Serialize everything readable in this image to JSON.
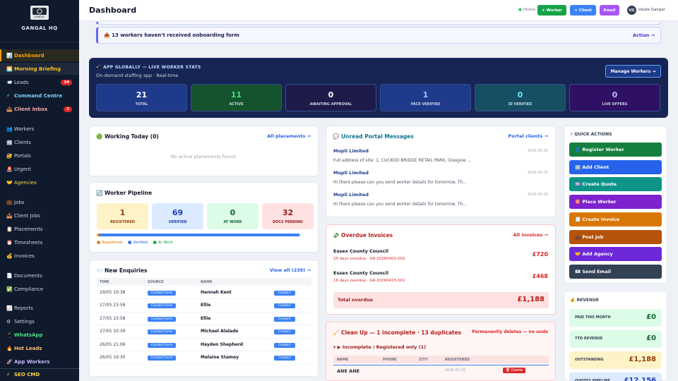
{
  "sidebar": {
    "brand": "GANGAL HQ",
    "logo_text": "GANGAL",
    "items": [
      {
        "icon": "📊",
        "label": "Dashboard"
      },
      {
        "icon": "🌅",
        "label": "Morning Briefing"
      },
      {
        "icon": "📨",
        "label": "Leads",
        "badge": "24"
      },
      {
        "icon": "⚡",
        "label": "Command Centre"
      },
      {
        "icon": "📥",
        "label": "Client Inbox",
        "badge": "2"
      },
      {
        "icon": "👥",
        "label": "Workers"
      },
      {
        "icon": "🏢",
        "label": "Clients"
      },
      {
        "icon": "🔐",
        "label": "Portals"
      },
      {
        "icon": "🚨",
        "label": "Urgent"
      },
      {
        "icon": "🤝",
        "label": "Agencies"
      },
      {
        "icon": "💼",
        "label": "Jobs"
      },
      {
        "icon": "📥",
        "label": "Client Jobs"
      },
      {
        "icon": "📋",
        "label": "Placements"
      },
      {
        "icon": "⏰",
        "label": "Timesheets"
      },
      {
        "icon": "💰",
        "label": "Invoices"
      },
      {
        "icon": "📄",
        "label": "Documents"
      },
      {
        "icon": "✅",
        "label": "Compliance"
      },
      {
        "icon": "📈",
        "label": "Reports"
      },
      {
        "icon": "⚙",
        "label": "Settings"
      },
      {
        "icon": "📱",
        "label": "WhatsApp"
      },
      {
        "icon": "🔥",
        "label": "Hot Leads"
      },
      {
        "icon": "🚀",
        "label": "App Workers"
      },
      {
        "icon": "⚡",
        "label": "SEO CMD"
      }
    ]
  },
  "topbar": {
    "title": "Dashboard",
    "status": "Online",
    "btn_worker": "+ Worker",
    "btn_client": "+ Client",
    "btn_email": "Email",
    "avatar": "VG",
    "user": "Vasile Gangal"
  },
  "onboarding": {
    "text": "📤 13 workers haven't received onboarding form",
    "action": "Action →"
  },
  "stats": {
    "heading": "📲 APP GLOBALLY — LIVE WORKER STATS",
    "subtitle": "On-demand staffing app · Real-time",
    "manage": "Manage Workers →",
    "items": [
      {
        "value": "21",
        "label": "TOTAL",
        "color": "#ffffff"
      },
      {
        "value": "11",
        "label": "ACTIVE",
        "color": "#4ade80"
      },
      {
        "value": "0",
        "label": "AWAITING APPROVAL",
        "color": "#ffffff"
      },
      {
        "value": "1",
        "label": "FACE VERIFIED",
        "color": "#93c5fd"
      },
      {
        "value": "0",
        "label": "ID VERIFIED",
        "color": "#67e8f9"
      },
      {
        "value": "0",
        "label": "LIVE OFFERS",
        "color": "#c4b5fd"
      }
    ]
  },
  "working": {
    "title": "🟢 Working Today (0)",
    "link": "All placements →",
    "empty": "No active placements found."
  },
  "pipeline": {
    "title": "🔄 Worker Pipeline",
    "items": [
      {
        "value": "1",
        "label": "REGISTERED"
      },
      {
        "value": "69",
        "label": "VERIFIED"
      },
      {
        "value": "0",
        "label": "AT WORK"
      },
      {
        "value": "32",
        "label": "DOCS PENDING"
      }
    ],
    "progress": {
      "registered": 0.012,
      "verified": 0.988,
      "at_work": 0
    },
    "legend": [
      "Registered",
      "Verified",
      "At Work"
    ]
  },
  "enquiries": {
    "title": "📨 New Enquiries",
    "link": "View all (239) →",
    "headers": [
      "TIME",
      "SOURCE",
      "NAME",
      ""
    ],
    "rows": [
      {
        "time": "29/05 10:38",
        "source": "Contact Form",
        "name": "Hannah Kent",
        "action": "Contact"
      },
      {
        "time": "27/05 23:58",
        "source": "Contact Form",
        "name": "Ellie",
        "action": "Contact"
      },
      {
        "time": "27/05 23:58",
        "source": "Contact Form",
        "name": "Ellie",
        "action": "Contact"
      },
      {
        "time": "27/05 10:39",
        "source": "Contact Form",
        "name": "Michael Alalade",
        "action": "Contact"
      },
      {
        "time": "26/05 21:06",
        "source": "Contact Form",
        "name": "Hayden Shepherd",
        "action": "Contact"
      },
      {
        "time": "26/05 19:30",
        "source": "Contact Form",
        "name": "Melaine Stamey",
        "action": "Contact"
      }
    ]
  },
  "messages": {
    "title": "💬 Unread Portal Messages",
    "link": "Portal clients →",
    "items": [
      {
        "sender": "Mopli Limited",
        "date": "2026-05-25",
        "body": "Full address of site: 1, CUCKOO BRIDGE RETAIL PARK, Glasgow ..."
      },
      {
        "sender": "Mopli Limited",
        "date": "2026-05-25",
        "body": "Hi there please can you send worker details for tomorrow. Th..."
      },
      {
        "sender": "Mopli Limited",
        "date": "2026-05-25",
        "body": "Hi there please can you send worker details for tomorrow. Th..."
      }
    ]
  },
  "invoices": {
    "title": "💸 Overdue Invoices",
    "link": "All invoices →",
    "items": [
      {
        "client": "Essex County Council",
        "info": "25 days overdue · GR-20260402-002",
        "amount": "£720"
      },
      {
        "client": "Essex County Council",
        "info": "18 days overdue · GR-20260415-001",
        "amount": "£468"
      }
    ],
    "total_label": "Total overdue",
    "total": "£1,188"
  },
  "cleanup": {
    "title": "🧹 Clean Up — 1 incomplete · 13 duplicates",
    "warn": "Permanently deletes — no undo",
    "section": "▾ ▶ Incomplete / Registered only (1)",
    "headers": [
      "NAME",
      "PHONE",
      "CITY",
      "REGISTERED"
    ],
    "row": {
      "name": "ANE ANE",
      "date": "2026-05-25",
      "action": "🗑 Delete"
    }
  },
  "quick_actions": {
    "title": "⚡ QUICK ACTIONS",
    "items": [
      {
        "label": "👤 Register Worker",
        "color": "#15803d"
      },
      {
        "label": "🏢 Add Client",
        "color": "#2563eb"
      },
      {
        "label": "💷 Create Quote",
        "color": "#0d9488"
      },
      {
        "label": "🎯 Place Worker",
        "color": "#7e22ce"
      },
      {
        "label": "🧾 Create Invoice",
        "color": "#d97706"
      },
      {
        "label": "💼 Post Job",
        "color": "#b45309"
      },
      {
        "label": "🤝 Add Agency",
        "color": "#6d28d9"
      },
      {
        "label": "📧 Send Email",
        "color": "#334155"
      }
    ]
  },
  "revenue": {
    "title": "💰 REVENUE",
    "items": [
      {
        "label": "PAID THIS MONTH",
        "value": "£0",
        "bg": "#dcfce7",
        "color": "#166534"
      },
      {
        "label": "YTD REVENUE",
        "value": "£0",
        "bg": "#dcfce7",
        "color": "#166534"
      },
      {
        "label": "OUTSTANDING",
        "value": "£1,188",
        "bg": "#fef3c7",
        "color": "#92400e"
      },
      {
        "label": "QUOTES PIPELINE",
        "value": "£12,156",
        "bg": "#dbeafe",
        "color": "#1e40af"
      }
    ]
  }
}
